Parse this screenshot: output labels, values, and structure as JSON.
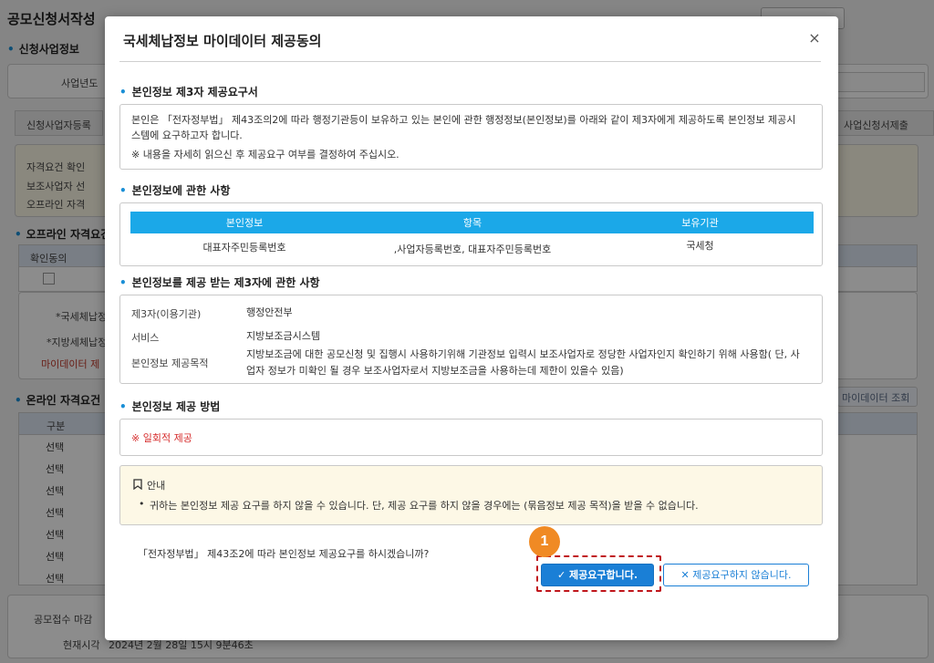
{
  "background": {
    "page_title": "공모신청서작성",
    "section_apply_business": "신청사업정보",
    "label_business_year": "사업년도",
    "tab_applicant_register": "신청사업자등록",
    "tab_right": "사업신청서제출",
    "qualify_notice_title": "자격요건 확인",
    "qualify_bullet_1": "보조사업자 선",
    "qualify_bullet_2": "오프라인 자격",
    "section_offline": "오프라인 자격요건",
    "grid_head_consent": "확인동의",
    "offline_row_1": "*국세체납정",
    "offline_row_2": "*지방세체납정",
    "offline_row_3": "마이데이터 제",
    "section_online": "온라인 자격요건",
    "mydata_button": "마이데이터 조회",
    "online_col_header": "구분",
    "online_rows": [
      "선택",
      "선택",
      "선택",
      "선택",
      "선택",
      "선택",
      "선택"
    ],
    "deadline_label": "공모접수 마감",
    "current_time_label": "현재시각",
    "current_time_value": "2024년 2월 28일 15시 9분46초"
  },
  "modal": {
    "title": "국세체납정보 마이데이터 제공동의",
    "close_symbol": "×",
    "section1": {
      "title": "본인정보 제3자 제공요구서",
      "line1": "본인은 「전자정부법」 제43조의2에 따라 행정기관등이 보유하고 있는 본인에 관한 행정정보(본인정보)를 아래와 같이 제3자에게 제공하도록 본인정보 제공시",
      "line2": "스템에 요구하고자 합니다.",
      "line3": "※ 내용을 자세히 읽으신 후 제공요구 여부를 결정하여 주십시오."
    },
    "section2": {
      "title": "본인정보에 관한 사항",
      "columns": [
        "본인정보",
        "항목",
        "보유기관"
      ],
      "row": [
        "대표자주민등록번호",
        ",사업자등록번호, 대표자주민등록번호",
        "국세청"
      ]
    },
    "section3": {
      "title": "본인정보를 제공 받는 제3자에 관한 사항",
      "k1": "제3자(이용기관)",
      "v1": "행정안전부",
      "k2": "서비스",
      "v2": "지방보조금시스템",
      "k3": "본인정보 제공목적",
      "v3_line1": "지방보조금에 대한 공모신청 및 집행시 사용하기위해 기관정보 입력시 보조사업자로 정당한 사업자인지 확인하기 위해 사용함( 단, 사",
      "v3_line2": "업자 정보가 미확인 될 경우 보조사업자로서 지방보조금을 사용하는데 제한이 있을수 있음)"
    },
    "section4": {
      "title": "본인정보 제공 방법",
      "method": "※ 일회적 제공"
    },
    "notice": {
      "title": "안내",
      "text": "귀하는 본인정보 제공 요구를 하지 않을 수 있습니다. 단, 제공 요구를 하지 않을 경우에는 (묶음정보 제공 목적)을 받을 수 없습니다."
    },
    "question": "「전자정부법」 제43조2에 따라 본인정보 제공요구를 하시겠습니까?",
    "confirm_button": "제공요구합니다.",
    "decline_button": "제공요구하지 않습니다.",
    "annotation_number": "1"
  },
  "colors": {
    "accent": "#1a7fd6",
    "table_header": "#1ba8e8",
    "method_red": "#d62b2b",
    "highlight": "#c0161b",
    "badge": "#f08a24",
    "notice_bg": "#fdf8e6"
  }
}
